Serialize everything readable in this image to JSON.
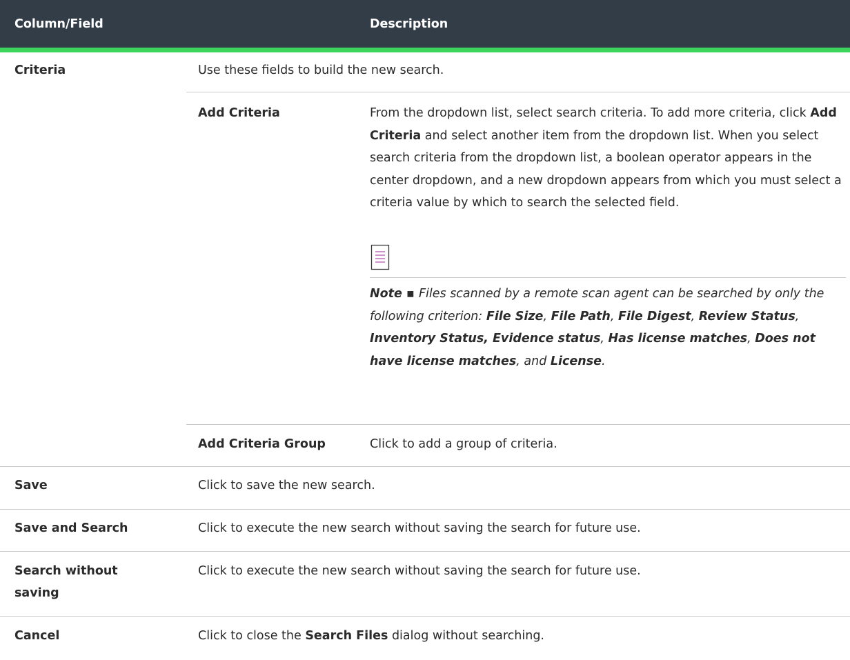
{
  "header": {
    "col1": "Column/Field",
    "col2": "Description"
  },
  "rows": {
    "criteria": {
      "field": "Criteria",
      "desc": "Use these fields to build the new search."
    },
    "add_criteria": {
      "field": "Add Criteria",
      "p1a": "From the dropdown list, select search criteria. To add more criteria, click ",
      "p1b": "Add Criteria",
      "p1c": " and select another item from the dropdown list. When you select search criteria from the dropdown list, a boolean operator appears in the center dropdown, and a new dropdown appears from which you must select a criteria value by which to search the selected field."
    },
    "note": {
      "label": "Note",
      "sep": " ▪ ",
      "t1": "Files scanned by a remote scan agent can be searched by only the following criterion: ",
      "b1": "File Size",
      "c1": ", ",
      "b2": "File Path",
      "c2": ", ",
      "b3": "File Digest",
      "c3": ", ",
      "b4": "Review Status",
      "c4": ", ",
      "b5": "Inventory Status, Evidence status",
      "c5": ", ",
      "b6": "Has license matches",
      "c6": ", ",
      "b7": "Does not have license matches",
      "c7": ", and ",
      "b8": "License",
      "c8": "."
    },
    "add_criteria_group": {
      "field": "Add Criteria Group",
      "desc": "Click to add a group of criteria."
    },
    "save": {
      "field": "Save",
      "desc": "Click to save the new search."
    },
    "save_and_search": {
      "field": "Save and Search",
      "desc": "Click to execute the new search without saving the search for future use."
    },
    "search_without_saving": {
      "field_line1": "Search without",
      "field_line2": "saving",
      "desc": "Click to execute the new search without saving the search for future use."
    },
    "cancel": {
      "field": "Cancel",
      "desc_a": "Click to close the ",
      "desc_b": "Search Files",
      "desc_c": " dialog without searching."
    }
  },
  "icons": {
    "note": "note-document-icon",
    "accent": "#3cd45a",
    "header_bg": "#333d47",
    "icon_color": "#b04aa8"
  }
}
